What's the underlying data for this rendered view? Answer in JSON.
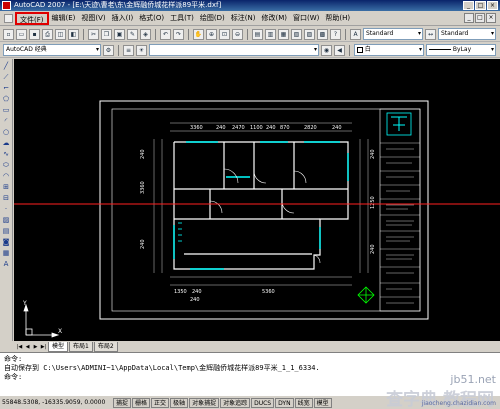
{
  "window": {
    "title": "AutoCAD 2007 - [E:\\天迹\\曹老\\东\\金辉融侨城花样派89平米.dxf]",
    "buttons": [
      "_",
      "□",
      "×"
    ]
  },
  "menubar": {
    "items": [
      "文件(F)",
      "编辑(E)",
      "视图(V)",
      "插入(I)",
      "格式(O)",
      "工具(T)",
      "绘图(D)",
      "标注(N)",
      "修改(M)",
      "窗口(W)",
      "帮助(H)"
    ],
    "active_index": 0,
    "mdi_buttons": [
      "_",
      "□",
      "×"
    ]
  },
  "toolbar1": {
    "text_style": "Standard",
    "dim_style": "Standard"
  },
  "toolbar2": {
    "workspace": "AutoCAD 经典",
    "color": "白",
    "linetype": "ByLay"
  },
  "drawing": {
    "dimensions": {
      "top": [
        "3360",
        "240",
        "2470",
        "1100",
        "240",
        "870",
        "2820",
        "240"
      ],
      "bottom": [
        "1350",
        "240",
        "5360",
        "240"
      ],
      "left": [
        "240",
        "3360",
        "240"
      ],
      "right": [
        "240",
        "1250",
        "240"
      ]
    },
    "accent_color": "#00ffff",
    "crosshair_color": "#ff0000"
  },
  "model_tabs": [
    "模型",
    "布局1",
    "布局2"
  ],
  "command": {
    "lines": [
      "命令:",
      "自动保存到 C:\\Users\\ADMINI~1\\AppData\\Local\\Temp\\金辉融侨城花样派89平米_1_1_6334.",
      "命令:"
    ]
  },
  "status": {
    "coords": "55848.5308, -16335.9059, 0.0000",
    "buttons": [
      "捕捉",
      "栅格",
      "正交",
      "极轴",
      "对象捕捉",
      "对象追踪",
      "DUCS",
      "DYN",
      "线宽",
      "模型"
    ]
  },
  "watermark": {
    "main": "查字典 教程网",
    "site": "jb51.net",
    "url": "jiaocheng.chazidian.com"
  }
}
